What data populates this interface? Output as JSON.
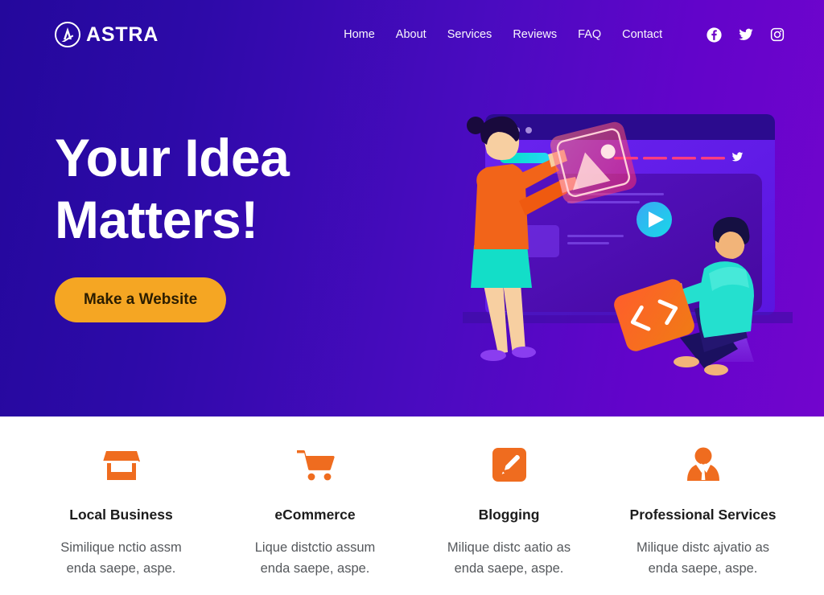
{
  "brand": {
    "name": "ASTRA",
    "logo_icon": "astra-circle-a-icon"
  },
  "nav": {
    "items": [
      {
        "label": "Home"
      },
      {
        "label": "About"
      },
      {
        "label": "Services"
      },
      {
        "label": "Reviews"
      },
      {
        "label": "FAQ"
      },
      {
        "label": "Contact"
      }
    ]
  },
  "socials": [
    {
      "name": "facebook-icon"
    },
    {
      "name": "twitter-icon"
    },
    {
      "name": "instagram-icon"
    }
  ],
  "hero": {
    "title_line1": "Your Idea",
    "title_line2": "Matters!",
    "cta_label": "Make a Website",
    "bg_from": "#24089c",
    "bg_to": "#7205cd",
    "cta_color": "#f5a623",
    "illustration": {
      "name": "team-building-website-illustration",
      "browser_dots": 3,
      "play_button": "play-icon",
      "image_card": "image-placeholder-card",
      "code_card": "code-card"
    }
  },
  "features": [
    {
      "icon": "store-icon",
      "title": "Local Business",
      "desc_line1": "Similique nctio assm",
      "desc_line2": "enda saepe, aspe."
    },
    {
      "icon": "shopping-cart-icon",
      "title": "eCommerce",
      "desc_line1": "Lique distctio assum",
      "desc_line2": "enda saepe, aspe."
    },
    {
      "icon": "pencil-edit-icon",
      "title": "Blogging",
      "desc_line1": "Milique distc aatio as",
      "desc_line2": "enda saepe, aspe."
    },
    {
      "icon": "businessman-icon",
      "title": "Professional Services",
      "desc_line1": "Milique distc ajvatio as",
      "desc_line2": "enda saepe, aspe."
    }
  ],
  "colors": {
    "accent_orange": "#ef6c1f",
    "text_dark": "#1c1c1c",
    "text_muted": "#55585c"
  }
}
